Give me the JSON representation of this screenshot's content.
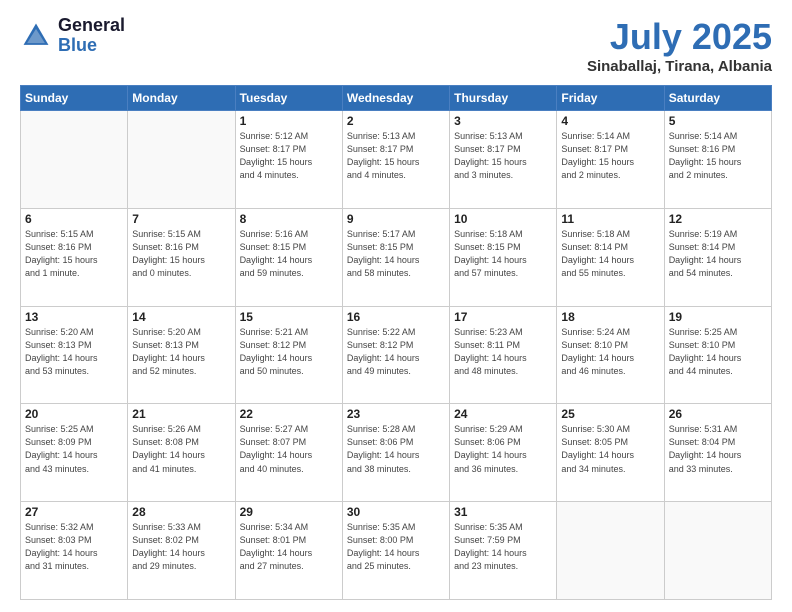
{
  "header": {
    "logo_general": "General",
    "logo_blue": "Blue",
    "title": "July 2025",
    "subtitle": "Sinaballaj, Tirana, Albania"
  },
  "weekdays": [
    "Sunday",
    "Monday",
    "Tuesday",
    "Wednesday",
    "Thursday",
    "Friday",
    "Saturday"
  ],
  "weeks": [
    [
      {
        "day": "",
        "info": ""
      },
      {
        "day": "",
        "info": ""
      },
      {
        "day": "1",
        "info": "Sunrise: 5:12 AM\nSunset: 8:17 PM\nDaylight: 15 hours\nand 4 minutes."
      },
      {
        "day": "2",
        "info": "Sunrise: 5:13 AM\nSunset: 8:17 PM\nDaylight: 15 hours\nand 4 minutes."
      },
      {
        "day": "3",
        "info": "Sunrise: 5:13 AM\nSunset: 8:17 PM\nDaylight: 15 hours\nand 3 minutes."
      },
      {
        "day": "4",
        "info": "Sunrise: 5:14 AM\nSunset: 8:17 PM\nDaylight: 15 hours\nand 2 minutes."
      },
      {
        "day": "5",
        "info": "Sunrise: 5:14 AM\nSunset: 8:16 PM\nDaylight: 15 hours\nand 2 minutes."
      }
    ],
    [
      {
        "day": "6",
        "info": "Sunrise: 5:15 AM\nSunset: 8:16 PM\nDaylight: 15 hours\nand 1 minute."
      },
      {
        "day": "7",
        "info": "Sunrise: 5:15 AM\nSunset: 8:16 PM\nDaylight: 15 hours\nand 0 minutes."
      },
      {
        "day": "8",
        "info": "Sunrise: 5:16 AM\nSunset: 8:15 PM\nDaylight: 14 hours\nand 59 minutes."
      },
      {
        "day": "9",
        "info": "Sunrise: 5:17 AM\nSunset: 8:15 PM\nDaylight: 14 hours\nand 58 minutes."
      },
      {
        "day": "10",
        "info": "Sunrise: 5:18 AM\nSunset: 8:15 PM\nDaylight: 14 hours\nand 57 minutes."
      },
      {
        "day": "11",
        "info": "Sunrise: 5:18 AM\nSunset: 8:14 PM\nDaylight: 14 hours\nand 55 minutes."
      },
      {
        "day": "12",
        "info": "Sunrise: 5:19 AM\nSunset: 8:14 PM\nDaylight: 14 hours\nand 54 minutes."
      }
    ],
    [
      {
        "day": "13",
        "info": "Sunrise: 5:20 AM\nSunset: 8:13 PM\nDaylight: 14 hours\nand 53 minutes."
      },
      {
        "day": "14",
        "info": "Sunrise: 5:20 AM\nSunset: 8:13 PM\nDaylight: 14 hours\nand 52 minutes."
      },
      {
        "day": "15",
        "info": "Sunrise: 5:21 AM\nSunset: 8:12 PM\nDaylight: 14 hours\nand 50 minutes."
      },
      {
        "day": "16",
        "info": "Sunrise: 5:22 AM\nSunset: 8:12 PM\nDaylight: 14 hours\nand 49 minutes."
      },
      {
        "day": "17",
        "info": "Sunrise: 5:23 AM\nSunset: 8:11 PM\nDaylight: 14 hours\nand 48 minutes."
      },
      {
        "day": "18",
        "info": "Sunrise: 5:24 AM\nSunset: 8:10 PM\nDaylight: 14 hours\nand 46 minutes."
      },
      {
        "day": "19",
        "info": "Sunrise: 5:25 AM\nSunset: 8:10 PM\nDaylight: 14 hours\nand 44 minutes."
      }
    ],
    [
      {
        "day": "20",
        "info": "Sunrise: 5:25 AM\nSunset: 8:09 PM\nDaylight: 14 hours\nand 43 minutes."
      },
      {
        "day": "21",
        "info": "Sunrise: 5:26 AM\nSunset: 8:08 PM\nDaylight: 14 hours\nand 41 minutes."
      },
      {
        "day": "22",
        "info": "Sunrise: 5:27 AM\nSunset: 8:07 PM\nDaylight: 14 hours\nand 40 minutes."
      },
      {
        "day": "23",
        "info": "Sunrise: 5:28 AM\nSunset: 8:06 PM\nDaylight: 14 hours\nand 38 minutes."
      },
      {
        "day": "24",
        "info": "Sunrise: 5:29 AM\nSunset: 8:06 PM\nDaylight: 14 hours\nand 36 minutes."
      },
      {
        "day": "25",
        "info": "Sunrise: 5:30 AM\nSunset: 8:05 PM\nDaylight: 14 hours\nand 34 minutes."
      },
      {
        "day": "26",
        "info": "Sunrise: 5:31 AM\nSunset: 8:04 PM\nDaylight: 14 hours\nand 33 minutes."
      }
    ],
    [
      {
        "day": "27",
        "info": "Sunrise: 5:32 AM\nSunset: 8:03 PM\nDaylight: 14 hours\nand 31 minutes."
      },
      {
        "day": "28",
        "info": "Sunrise: 5:33 AM\nSunset: 8:02 PM\nDaylight: 14 hours\nand 29 minutes."
      },
      {
        "day": "29",
        "info": "Sunrise: 5:34 AM\nSunset: 8:01 PM\nDaylight: 14 hours\nand 27 minutes."
      },
      {
        "day": "30",
        "info": "Sunrise: 5:35 AM\nSunset: 8:00 PM\nDaylight: 14 hours\nand 25 minutes."
      },
      {
        "day": "31",
        "info": "Sunrise: 5:35 AM\nSunset: 7:59 PM\nDaylight: 14 hours\nand 23 minutes."
      },
      {
        "day": "",
        "info": ""
      },
      {
        "day": "",
        "info": ""
      }
    ]
  ]
}
